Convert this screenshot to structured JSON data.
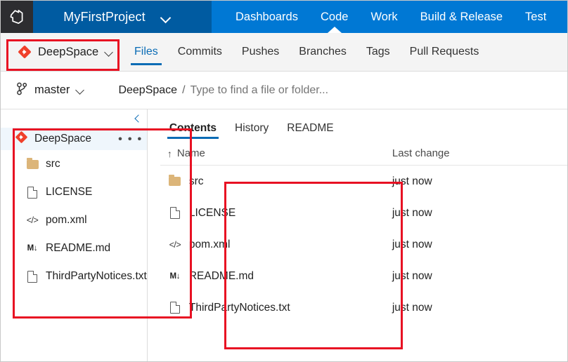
{
  "header": {
    "logo_icon": "azure-devops-logo-icon",
    "project_name": "MyFirstProject",
    "project_chevron_icon": "chevron-down-icon",
    "nav_items": [
      {
        "label": "Dashboards",
        "active": false
      },
      {
        "label": "Code",
        "active": true
      },
      {
        "label": "Work",
        "active": false
      },
      {
        "label": "Build & Release",
        "active": false
      },
      {
        "label": "Test",
        "active": false
      }
    ]
  },
  "repo_bar": {
    "repo_icon": "git-repository-icon",
    "repo_name": "DeepSpace",
    "repo_chevron_icon": "chevron-down-icon",
    "tabs": [
      {
        "label": "Files",
        "active": true
      },
      {
        "label": "Commits",
        "active": false
      },
      {
        "label": "Pushes",
        "active": false
      },
      {
        "label": "Branches",
        "active": false
      },
      {
        "label": "Tags",
        "active": false
      },
      {
        "label": "Pull Requests",
        "active": false
      }
    ]
  },
  "breadcrumb": {
    "branch_icon": "git-branch-icon",
    "branch_name": "master",
    "branch_chevron_icon": "chevron-down-icon",
    "repo_crumb": "DeepSpace",
    "separator": "/",
    "search_placeholder": "Type to find a file or folder..."
  },
  "tree_pane": {
    "collapse_icon": "chevron-left-icon",
    "root": {
      "icon": "git-repository-icon",
      "label": "DeepSpace",
      "more_label": "• • •",
      "more_icon": "ellipsis-icon"
    },
    "items": [
      {
        "label": "src",
        "icon": "folder-icon"
      },
      {
        "label": "LICENSE",
        "icon": "file-icon"
      },
      {
        "label": "pom.xml",
        "icon": "code-file-icon",
        "glyph": "</>"
      },
      {
        "label": "README.md",
        "icon": "markdown-file-icon",
        "glyph": "M↓"
      },
      {
        "label": "ThirdPartyNotices.txt",
        "icon": "file-icon"
      }
    ]
  },
  "content_pane": {
    "tabs": [
      {
        "label": "Contents",
        "active": true
      },
      {
        "label": "History",
        "active": false
      },
      {
        "label": "README",
        "active": false
      }
    ],
    "columns": {
      "sort_arrow": "↑",
      "name": "Name",
      "last_change": "Last change"
    },
    "rows": [
      {
        "name": "src",
        "icon": "folder-icon",
        "last_change": "just now"
      },
      {
        "name": "LICENSE",
        "icon": "file-icon",
        "last_change": "just now"
      },
      {
        "name": "pom.xml",
        "icon": "code-file-icon",
        "glyph": "</>",
        "last_change": "just now"
      },
      {
        "name": "README.md",
        "icon": "markdown-file-icon",
        "glyph": "M↓",
        "last_change": "just now"
      },
      {
        "name": "ThirdPartyNotices.txt",
        "icon": "file-icon",
        "last_change": "just now"
      }
    ]
  },
  "annotations": {
    "color": "#e81123",
    "boxes": [
      {
        "name": "repo-selector-highlight"
      },
      {
        "name": "file-tree-highlight"
      },
      {
        "name": "file-list-highlight"
      }
    ]
  },
  "colors": {
    "header_project": "#005ba1",
    "header_nav": "#0078d4",
    "logo_tile": "#2d2d30",
    "accent_blue": "#0b6cb5",
    "selected_row": "#eff6fc",
    "folder": "#dcb579",
    "repo_red": "#f0402b",
    "annotation_red": "#e81123"
  }
}
